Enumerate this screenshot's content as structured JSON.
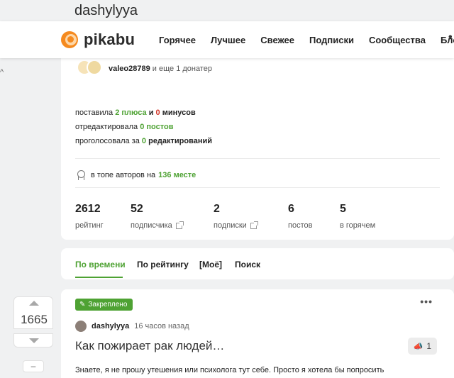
{
  "profile": {
    "username": "dashylyya"
  },
  "header": {
    "logo_text": "pikabu",
    "nav": [
      "Горячее",
      "Лучшее",
      "Свежее",
      "Подписки",
      "Сообщества",
      "Блоги"
    ],
    "more": "•"
  },
  "donors": {
    "name": "valeo28789",
    "rest": "и еще 1 донатер"
  },
  "activity": {
    "line1_a": "поставила",
    "pluses": "2 плюса",
    "line1_b": "и",
    "minuses": "0",
    "line1_c": "минусов",
    "line2_a": "отредактировала",
    "posts": "0 постов",
    "line3_a": "проголосовала за",
    "edits_num": "0",
    "line3_b": "редактирований"
  },
  "top_authors": {
    "text": "в топе авторов на",
    "place": "136 месте"
  },
  "metrics": [
    {
      "value": "2612",
      "label": "рейтинг"
    },
    {
      "value": "52",
      "label": "подписчика"
    },
    {
      "value": "2",
      "label": "подписки"
    },
    {
      "value": "6",
      "label": "постов"
    },
    {
      "value": "5",
      "label": "в горячем"
    }
  ],
  "tabs": [
    "По времени",
    "По рейтингу",
    "[Моё]",
    "Поиск"
  ],
  "active_tab": "По времени",
  "post": {
    "votes": "1665",
    "collapse": "–",
    "pinned_label": "Закреплено",
    "author": "dashylyya",
    "time": "16 часов назад",
    "title": "Как пожирает рак людей…",
    "comments_count": "1",
    "excerpt": "Знаете, я не прошу утешения или психолога тут себе. Просто я хотела бы попросить"
  },
  "colors": {
    "accent": "#4ea233",
    "minus": "#d3382b",
    "logo": "#f58a1f"
  }
}
